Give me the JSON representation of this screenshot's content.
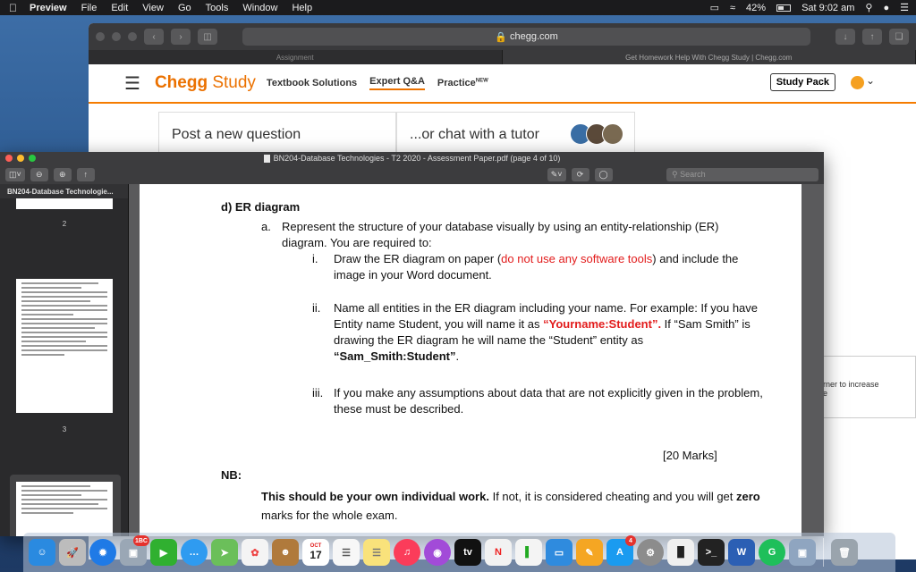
{
  "menubar": {
    "app_name": "Preview",
    "items": [
      "File",
      "Edit",
      "View",
      "Go",
      "Tools",
      "Window",
      "Help"
    ],
    "battery_text": "42%",
    "clock": "Sat 9:02 am"
  },
  "safari": {
    "url": "chegg.com",
    "tabs": [
      {
        "label": "Assignment"
      },
      {
        "label": "Get Homework Help With Chegg Study | Chegg.com"
      }
    ],
    "nav": {
      "logo_bold": "Chegg",
      "logo_light": "Study",
      "links": [
        "Textbook Solutions",
        "Expert Q&A",
        "Practice"
      ],
      "practice_badge": "NEW",
      "study_pack": "Study Pack"
    },
    "post_question": "Post a new question",
    "chat_tutor": "...or chat with a tutor",
    "side_snippet_line1": "rner to increase",
    "side_snippet_line2": "e"
  },
  "preview": {
    "title": "BN204-Database Technologies - T2 2020 - Assessment Paper.pdf (page 4 of 10)",
    "search_placeholder": "Search",
    "sidebar_header": "BN204-Database Technologie...",
    "page_numbers": [
      "2",
      "3"
    ]
  },
  "document": {
    "section": "d)  ER diagram",
    "a_label": "a.",
    "a_text": "Represent the structure of your database visually by using an entity-relationship (ER) diagram. You are required to:",
    "i_num": "i.",
    "i_text_1": "Draw the ER diagram on paper (",
    "i_text_red": "do not use any software tools",
    "i_text_2": ") and include the image in your Word document.",
    "ii_num": "ii.",
    "ii_text_1": "Name all entities in the ER diagram including your name. For example: If you have Entity name Student, you will name it as ",
    "ii_text_red": "“Yourname:Student”.",
    "ii_text_2": " If “Sam Smith” is drawing the ER diagram he will name the “Student” entity as ",
    "ii_text_bold": "“Sam_Smith:Student”",
    "ii_text_3": ".",
    "iii_num": "iii.",
    "iii_text": "If you make any assumptions about data that are not explicitly given in the problem, these must be described.",
    "marks": "[20 Marks]",
    "nb": "NB:",
    "nb_bold": "This should be your own individual work.",
    "nb_text_1": " If not, it is considered cheating and you will get ",
    "nb_zero": "zero",
    "nb_text_2": " marks for the whole exam."
  },
  "dock": {
    "calendar_day": "17",
    "calendar_month": "OCT",
    "badge_photo": "1BC",
    "badge_appstore": "4"
  }
}
